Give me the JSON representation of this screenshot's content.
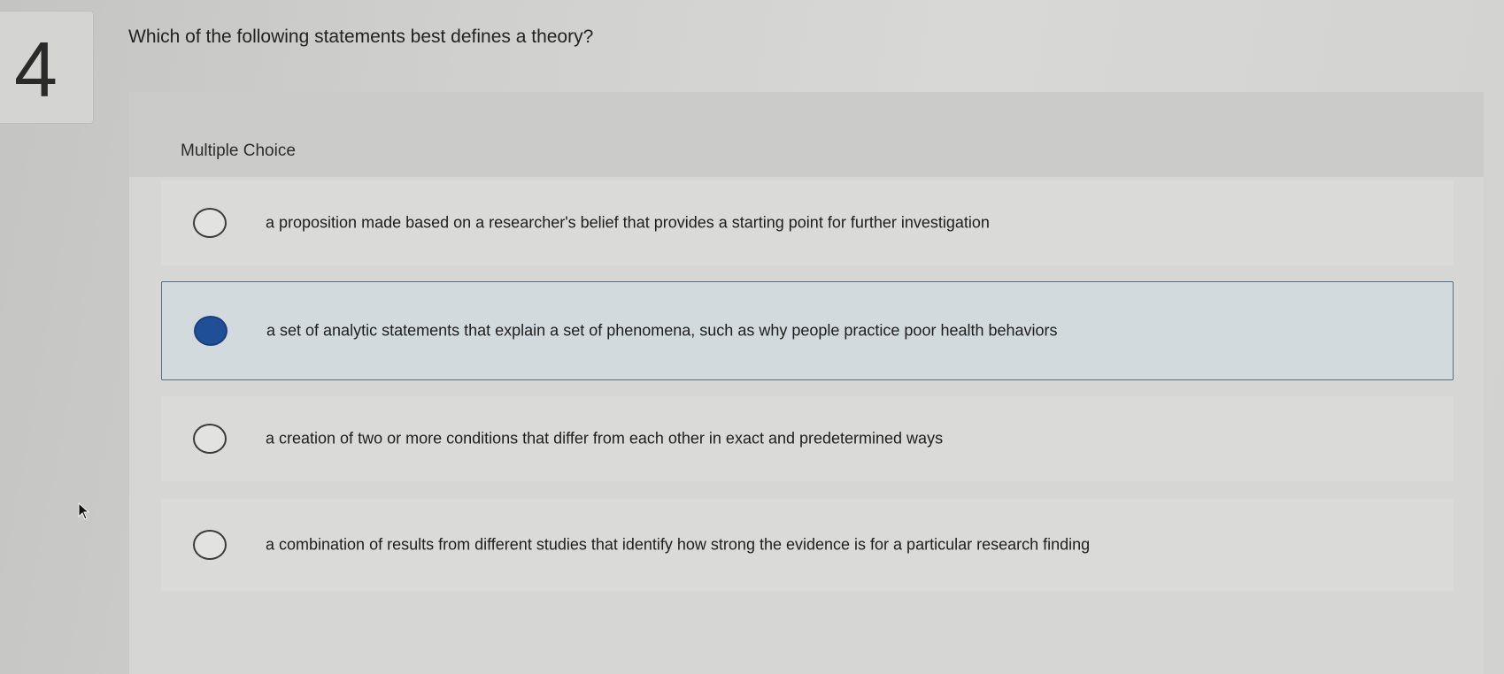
{
  "question": {
    "number": "4",
    "text": "Which of the following statements best defines a theory?"
  },
  "answer_panel": {
    "type_label": "Multiple Choice",
    "selected_index": 1,
    "options": [
      {
        "text": "a proposition made based on a researcher's belief that provides a starting point for further investigation",
        "selected": false
      },
      {
        "text": "a set of analytic statements that explain a set of phenomena, such as why people practice poor health behaviors",
        "selected": true
      },
      {
        "text": "a creation of two or more conditions that differ from each other in exact and predetermined ways",
        "selected": false
      },
      {
        "text": "a combination of results from different studies that identify how strong the evidence is for a particular research finding",
        "selected": false
      }
    ]
  },
  "colors": {
    "selected_radio": "#1f4f96",
    "selected_border": "#5a6f82"
  },
  "icons": {
    "cursor": "mouse-pointer-icon"
  }
}
